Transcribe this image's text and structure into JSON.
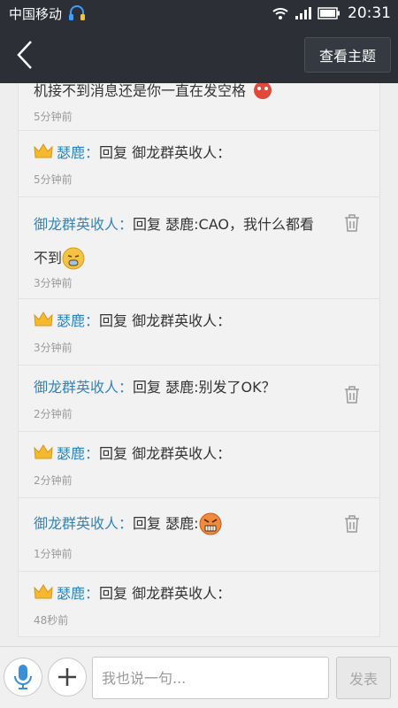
{
  "status_bar": {
    "carrier": "中国移动",
    "time": "20:31"
  },
  "nav": {
    "topic_button": "查看主题"
  },
  "partial": {
    "text": "机接不到消息还是你一直在发空格",
    "time": "5分钟前"
  },
  "replies": [
    {
      "author": "瑟鹿",
      "crown": true,
      "sep": "：",
      "reply_word": "回复",
      "target": "御龙群英收人：",
      "content": "",
      "time": "5分钟前"
    },
    {
      "author": "御龙群英收人",
      "crown": false,
      "sep": "：",
      "reply_word": "回复",
      "target": "瑟鹿",
      "content": ":CAO，我什么都看不到",
      "emoji": "tired-face-emoji",
      "time": "3分钟前",
      "trash": true
    },
    {
      "author": "瑟鹿",
      "crown": true,
      "sep": "：",
      "reply_word": "回复",
      "target": "御龙群英收人：",
      "content": "",
      "time": "3分钟前"
    },
    {
      "author": "御龙群英收人",
      "crown": false,
      "sep": "：",
      "reply_word": "回复",
      "target": "瑟鹿",
      "content": ":别发了OK？",
      "time": "2分钟前",
      "trash": true
    },
    {
      "author": "瑟鹿",
      "crown": true,
      "sep": "：",
      "reply_word": "回复",
      "target": "御龙群英收人：",
      "content": "",
      "time": "2分钟前"
    },
    {
      "author": "御龙群英收人",
      "crown": false,
      "sep": "：",
      "reply_word": "回复",
      "target": "瑟鹿",
      "content": ":",
      "emoji": "angry-grimace-emoji",
      "time": "1分钟前",
      "trash": true
    },
    {
      "author": "瑟鹿",
      "crown": true,
      "sep": "：",
      "reply_word": "回复",
      "target": "御龙群英收人：",
      "content": "",
      "time": "48秒前"
    }
  ],
  "input_bar": {
    "placeholder": "我也说一句...",
    "send_label": "发表"
  },
  "colors": {
    "bar": "#2c2f36",
    "name": "#2e86c1",
    "crown": "#f5b82e"
  }
}
